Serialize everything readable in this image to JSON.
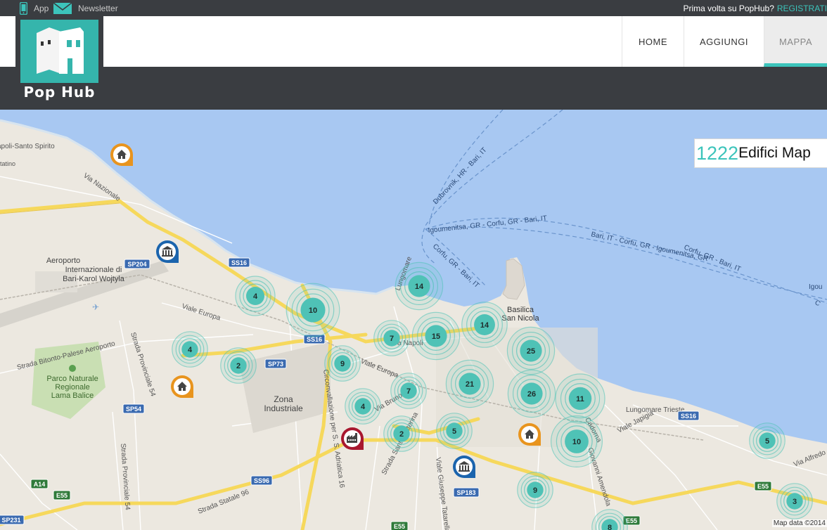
{
  "topbar": {
    "app_label": "App",
    "newsletter_label": "Newsletter",
    "first_time_text": "Prima volta su PopHub?",
    "register_label": "REGISTRATI"
  },
  "logo": {
    "text": "Pop Hub"
  },
  "nav": {
    "home": "HOME",
    "add": "AGGIUNGI",
    "map": "MAPPA"
  },
  "counter": {
    "value": "1222",
    "label": "Edifici Map"
  },
  "map": {
    "attribution": "Map data ©2014",
    "labels": {
      "napoli_santo_spirito": "apoli-Santo Spirito",
      "tatino": "tatino",
      "via_nazionale": "Via Nazionale",
      "aeroporto_1": "Aeroporto",
      "aeroporto_2": "Internazionale di",
      "aeroporto_3": "Bari-Karol Wojtyla",
      "viale_europa": "Viale Europa",
      "strada_bitonto": "Strada Bitonto-Palese Aeroporto",
      "strada_prov_54a": "Strada Provinciale 54",
      "strada_prov_54b": "Strada Provinciale 54",
      "parco_1": "Parco Naturale",
      "parco_2": "Regionale",
      "parco_3": "Lama Balice",
      "zona_1": "Zona",
      "zona_2": "Industriale",
      "circonvallazione": "Circonvallazione per S. S. Adriatica 16",
      "via_napoli": "a Napoli",
      "viale_europa2": "Viale Europa",
      "via_bruno": "Via Bruno Bu",
      "strada_s_caterina": "Strada Santa Caterina",
      "strada_statale_96": "Strada Statale 96",
      "viale_giuseppe": "Viale Giuseppe Tatarella",
      "lungomare": "Lungomare",
      "basilica_1": "Basilica",
      "basilica_2": "San Nicola",
      "lungomare_trieste": "Lungomare Trieste",
      "viale_japigia": "Viale Japigia",
      "via_alfredo": "Via Alfredo",
      "giovanni_amendola": "Giovanni Amendola",
      "cadorna": "Cadorna",
      "ferry_dubrovnik": "Dubrovnik, HR - Bari, IT",
      "ferry_igoumenitsa": "Igoumenitsa, GR - Corfu, GR - Bari, IT",
      "ferry_corfu": "Corfu, GR - Bari, IT",
      "ferry_bari_corfu": "Bari, IT - Corfu, GR - Igoumenitsa, GR",
      "ferry_corfu2": "Corfu, GR - Bari, IT",
      "ferry_igo": "Igou",
      "ferry_c": "C"
    },
    "road_shields": {
      "sp204": "SP204",
      "ss16a": "SS16",
      "ss16b": "SS16",
      "sp73": "SP73",
      "sp54": "SP54",
      "a14": "A14",
      "e55a": "E55",
      "sp231": "SP231",
      "ss96": "SS96",
      "e55b": "E55",
      "sp183": "SP183",
      "ss16c": "SS16",
      "e55c": "E55",
      "e55d": "E55"
    },
    "clusters": [
      {
        "count": "4"
      },
      {
        "count": "10"
      },
      {
        "count": "14"
      },
      {
        "count": "7"
      },
      {
        "count": "15"
      },
      {
        "count": "14"
      },
      {
        "count": "25"
      },
      {
        "count": "4"
      },
      {
        "count": "2"
      },
      {
        "count": "9"
      },
      {
        "count": "7"
      },
      {
        "count": "21"
      },
      {
        "count": "26"
      },
      {
        "count": "11"
      },
      {
        "count": "4"
      },
      {
        "count": "2"
      },
      {
        "count": "5"
      },
      {
        "count": "10"
      },
      {
        "count": "5"
      },
      {
        "count": "9"
      },
      {
        "count": "3"
      },
      {
        "count": "8"
      }
    ],
    "colors": {
      "sea": "#a8c8f2",
      "land": "#ece8e0",
      "road_major": "#f6d85c",
      "cluster": "#4fc2b6",
      "pin_home": "#e8941e",
      "pin_museum": "#1b64ad",
      "pin_factory": "#a8172f",
      "accent": "#3cc4bb"
    }
  }
}
